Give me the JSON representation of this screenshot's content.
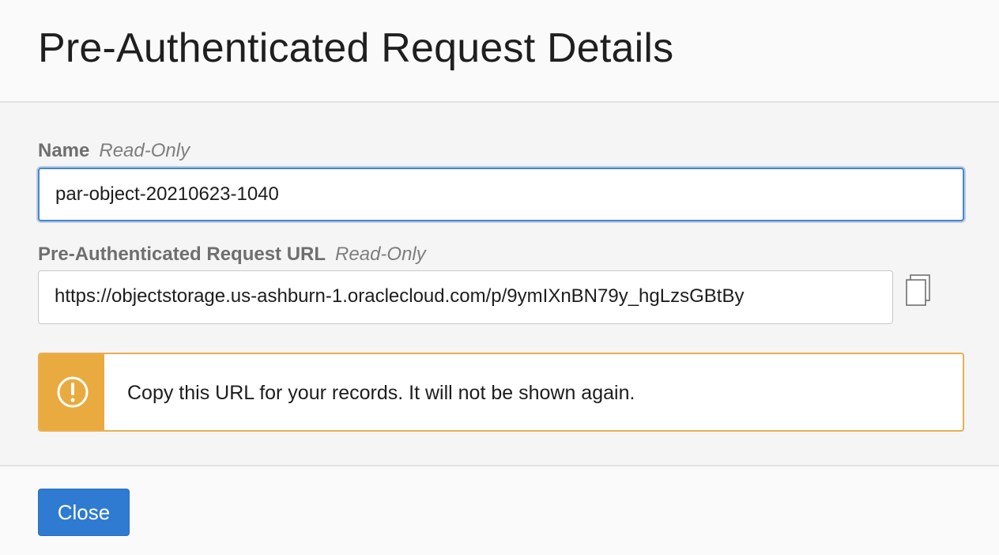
{
  "dialog": {
    "title": "Pre-Authenticated Request Details"
  },
  "fields": {
    "name": {
      "label": "Name",
      "badge": "Read-Only",
      "value": "par-object-20210623-1040"
    },
    "url": {
      "label": "Pre-Authenticated Request URL",
      "badge": "Read-Only",
      "value": "https://objectstorage.us-ashburn-1.oraclecloud.com/p/9ymIXnBN79y_hgLzsGBtBy",
      "copy_icon": "copy-icon"
    }
  },
  "alert": {
    "type": "warning",
    "icon": "warning-icon",
    "text": "Copy this URL for your records. It will not be shown again.",
    "color": "#e9ab3f"
  },
  "footer": {
    "close_label": "Close",
    "accent_color": "#2e7bd1"
  }
}
